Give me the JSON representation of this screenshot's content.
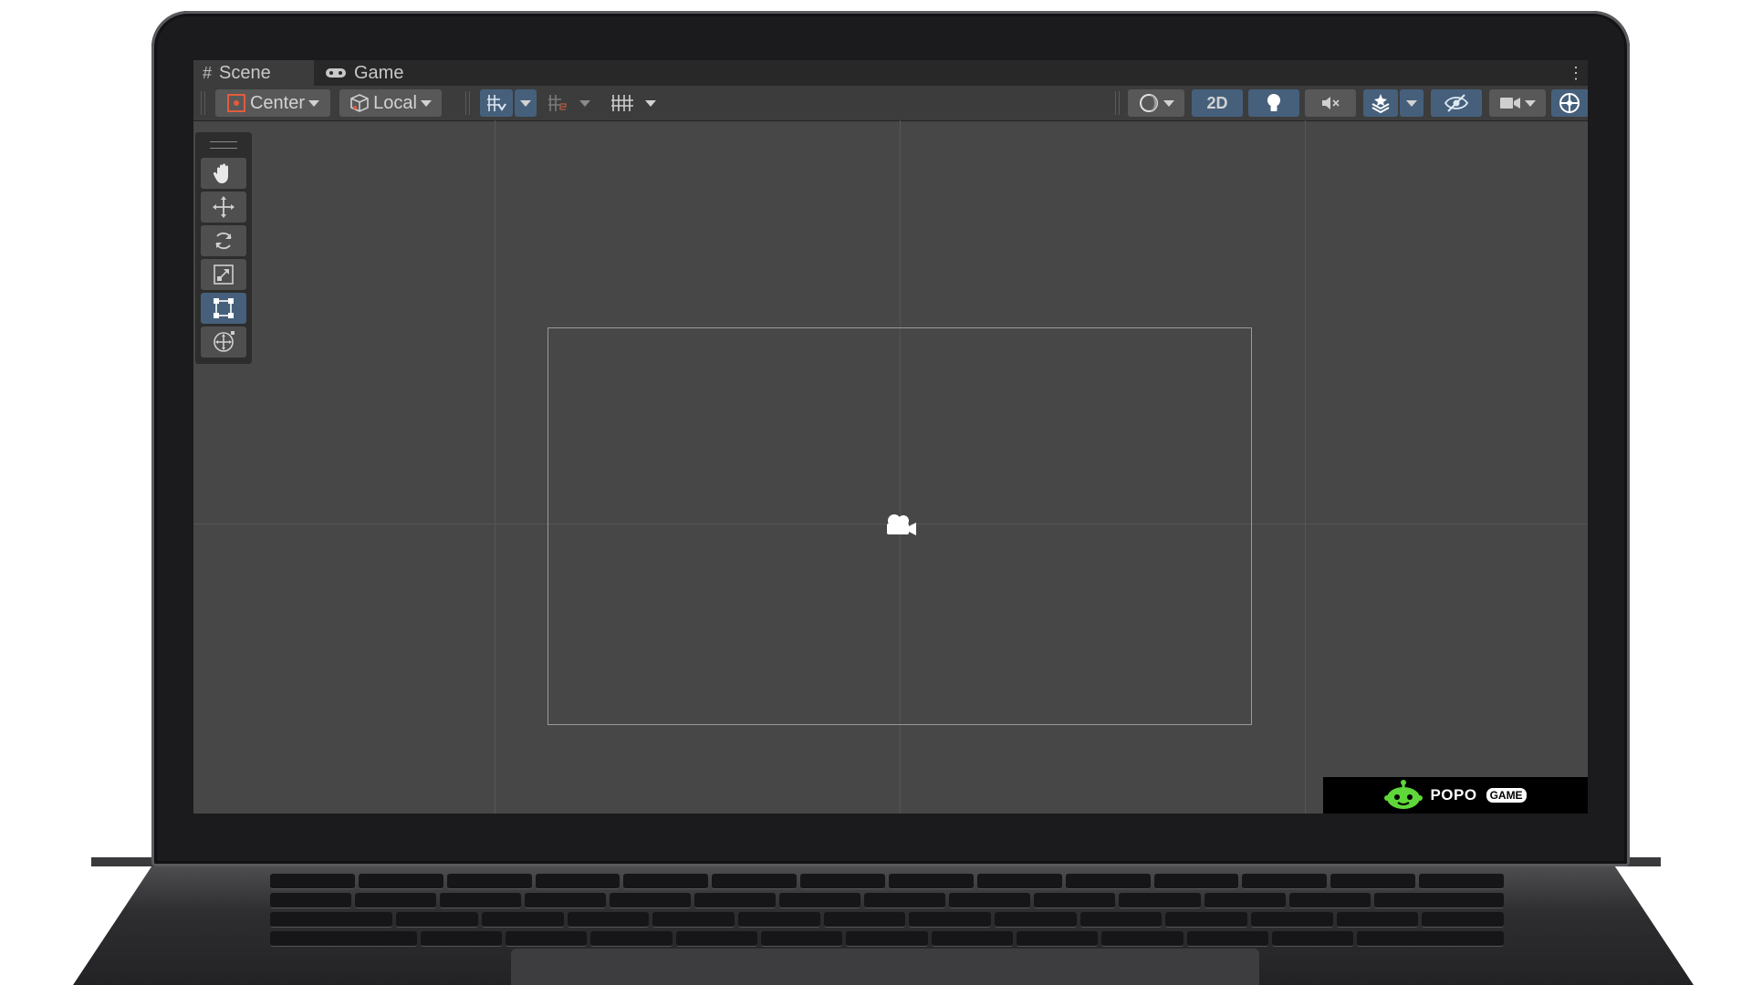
{
  "tabs": {
    "scene": {
      "label": "Scene",
      "icon": "grid-hash-icon"
    },
    "game": {
      "label": "Game",
      "icon": "gamepad-icon"
    }
  },
  "toolbar": {
    "pivot_label": "Center",
    "pivot_icon": "pivot-center-icon",
    "space_label": "Local",
    "space_icon": "local-cube-icon",
    "view_2d_label": "2D",
    "icons": [
      "grid-snap-icon",
      "snap-increment-icon",
      "grid-visibility-icon",
      "draw-mode-icon",
      "lighting-icon",
      "audio-mute-icon",
      "effects-icon",
      "hidden-objects-icon",
      "camera-icon",
      "gizmos-icon"
    ]
  },
  "tools": {
    "items": [
      "hand-tool-icon",
      "move-tool-icon",
      "rotate-tool-icon",
      "scale-tool-icon",
      "rect-tool-icon",
      "transform-tool-icon"
    ],
    "selected": "rect-tool-icon"
  },
  "scene": {
    "center_icon": "camera-gizmo-icon"
  },
  "watermark": {
    "text": "POPO",
    "pill": "GAME",
    "icon": "popo-robot-logo-icon"
  },
  "colors": {
    "scene_bg": "#474747",
    "toolbar_bg": "#3c3c3c",
    "selected_blue": "#46607c",
    "logo_green": "#5fd63a"
  }
}
